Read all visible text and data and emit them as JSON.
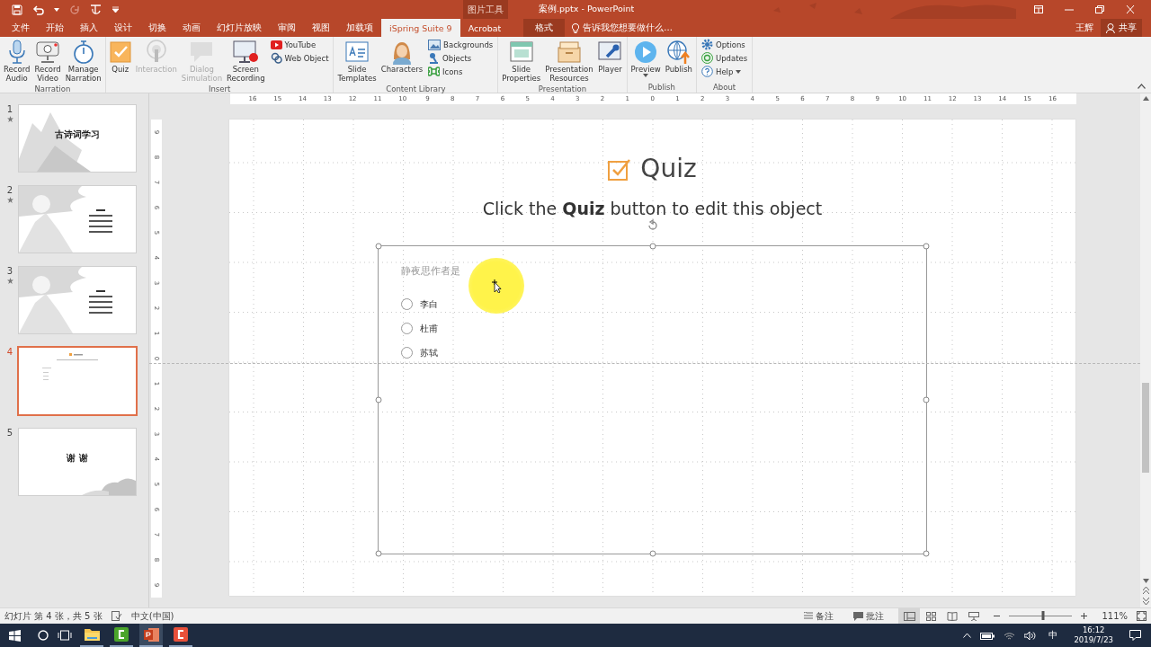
{
  "title_bar": {
    "context_label": "图片工具",
    "title": "案例.pptx - PowerPoint"
  },
  "tabs": [
    {
      "label": "文件",
      "selected": false,
      "kind": "normal"
    },
    {
      "label": "开始",
      "selected": false,
      "kind": "normal"
    },
    {
      "label": "插入",
      "selected": false,
      "kind": "normal"
    },
    {
      "label": "设计",
      "selected": false,
      "kind": "normal"
    },
    {
      "label": "切换",
      "selected": false,
      "kind": "normal"
    },
    {
      "label": "动画",
      "selected": false,
      "kind": "normal"
    },
    {
      "label": "幻灯片放映",
      "selected": false,
      "kind": "normal"
    },
    {
      "label": "审阅",
      "selected": false,
      "kind": "normal"
    },
    {
      "label": "视图",
      "selected": false,
      "kind": "normal"
    },
    {
      "label": "加载项",
      "selected": false,
      "kind": "normal"
    },
    {
      "label": "iSpring Suite 9",
      "selected": true,
      "kind": "normal"
    },
    {
      "label": "Acrobat",
      "selected": false,
      "kind": "normal"
    },
    {
      "label": "格式",
      "selected": false,
      "kind": "contextual"
    }
  ],
  "tell_me": {
    "text": "告诉我您想要做什么..."
  },
  "account": {
    "user": "王辉",
    "share": "共享"
  },
  "ribbon": {
    "groups": [
      {
        "label": "Narration",
        "items": [
          {
            "kind": "large",
            "label": "Record Audio",
            "disabled": false,
            "dropdown": false
          },
          {
            "kind": "large",
            "label": "Record Video",
            "disabled": false,
            "dropdown": false
          },
          {
            "kind": "large",
            "label": "Manage Narration",
            "disabled": false,
            "dropdown": false
          }
        ]
      },
      {
        "label": "Insert",
        "items": [
          {
            "kind": "large",
            "label": "Quiz",
            "disabled": false,
            "dropdown": false
          },
          {
            "kind": "large",
            "label": "Interaction",
            "disabled": true,
            "dropdown": false
          },
          {
            "kind": "large",
            "label": "Dialog Simulation",
            "disabled": true,
            "dropdown": false
          },
          {
            "kind": "large",
            "label": "Screen Recording",
            "disabled": false,
            "dropdown": false
          },
          {
            "kind": "stack",
            "items": [
              {
                "label": "YouTube",
                "disabled": false,
                "dropdown": false
              },
              {
                "label": "Web Object",
                "disabled": false,
                "dropdown": false
              }
            ]
          }
        ]
      },
      {
        "label": "Content Library",
        "items": [
          {
            "kind": "large",
            "label": "Slide Templates",
            "disabled": false,
            "dropdown": false
          },
          {
            "kind": "large",
            "label": "Characters",
            "disabled": false,
            "dropdown": false
          },
          {
            "kind": "stack",
            "items": [
              {
                "label": "Backgrounds",
                "disabled": false,
                "dropdown": false
              },
              {
                "label": "Objects",
                "disabled": false,
                "dropdown": false
              },
              {
                "label": "Icons",
                "disabled": false,
                "dropdown": false
              }
            ]
          }
        ]
      },
      {
        "label": "Presentation",
        "items": [
          {
            "kind": "large",
            "label": "Slide Properties",
            "disabled": false,
            "dropdown": false
          },
          {
            "kind": "large",
            "label": "Presentation Resources",
            "disabled": false,
            "dropdown": false
          },
          {
            "kind": "large",
            "label": "Player",
            "disabled": false,
            "dropdown": false
          }
        ]
      },
      {
        "label": "Publish",
        "items": [
          {
            "kind": "large",
            "label": "Preview",
            "disabled": false,
            "dropdown": true
          },
          {
            "kind": "large",
            "label": "Publish",
            "disabled": false,
            "dropdown": false
          }
        ]
      },
      {
        "label": "About",
        "items": [
          {
            "kind": "stack",
            "items": [
              {
                "label": "Options",
                "disabled": false,
                "dropdown": false
              },
              {
                "label": "Updates",
                "disabled": false,
                "dropdown": false
              },
              {
                "label": "Help",
                "disabled": false,
                "dropdown": true
              }
            ]
          }
        ]
      }
    ]
  },
  "slides": [
    {
      "number": "1",
      "animated": true,
      "selected": false,
      "kind": "title",
      "title": "古诗词学习"
    },
    {
      "number": "2",
      "animated": true,
      "selected": false,
      "kind": "poem"
    },
    {
      "number": "3",
      "animated": true,
      "selected": false,
      "kind": "poem"
    },
    {
      "number": "4",
      "animated": false,
      "selected": true,
      "kind": "quiz"
    },
    {
      "number": "5",
      "animated": false,
      "selected": false,
      "kind": "closing",
      "title": "谢 谢"
    }
  ],
  "rulers": {
    "horizontal": [
      "16",
      "15",
      "14",
      "13",
      "12",
      "11",
      "10",
      "9",
      "8",
      "7",
      "6",
      "5",
      "4",
      "3",
      "2",
      "1",
      "0",
      "1",
      "2",
      "3",
      "4",
      "5",
      "6",
      "7",
      "8",
      "9",
      "10",
      "11",
      "12",
      "13",
      "14",
      "15",
      "16"
    ],
    "vertical": [
      "9",
      "8",
      "7",
      "6",
      "5",
      "4",
      "3",
      "2",
      "1",
      "0",
      "1",
      "2",
      "3",
      "4",
      "5",
      "6",
      "7",
      "8",
      "9"
    ]
  },
  "slide": {
    "title": "Quiz",
    "subtitle": "Click the **Quiz** button to edit this object",
    "question": "静夜思作者是",
    "options": [
      {
        "label": "李白",
        "selected": false
      },
      {
        "label": "杜甫",
        "selected": false
      },
      {
        "label": "苏轼",
        "selected": false
      }
    ]
  },
  "status_bar": {
    "slide_info": "幻灯片 第 4 张，共 5 张",
    "language": "中文(中国)",
    "notes": "备注",
    "comments": "批注",
    "views": [
      {
        "selected": true
      },
      {
        "selected": false
      },
      {
        "selected": false
      },
      {
        "selected": false
      }
    ],
    "zoom": {
      "level": 0.54,
      "value": "111%"
    }
  },
  "taskbar": {
    "apps": [
      {
        "selected": false
      },
      {
        "selected": false
      },
      {
        "selected": true
      },
      {
        "selected": false
      }
    ],
    "ime": "中",
    "time": "16:12",
    "date": "2019/7/23"
  }
}
